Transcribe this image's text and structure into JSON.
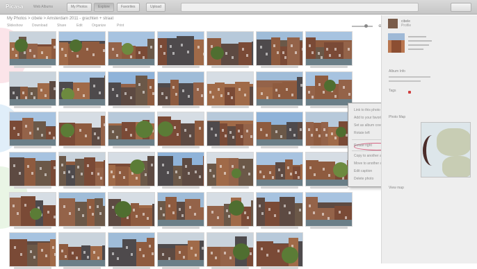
{
  "app": {
    "logo": "Picasa",
    "subtitle": "Web Albums"
  },
  "nav": {
    "items": [
      "My Photos",
      "Explore",
      "Favorites",
      "Upload"
    ],
    "active_index": 1
  },
  "breadcrumb": "My Photos > cibele > Amsterdam 2011 - grachten + straat",
  "toolbar": {
    "items": [
      "Slideshow",
      "Download",
      "Share",
      "Edit",
      "Organize",
      "Print"
    ]
  },
  "colors": {
    "accent": "#d46080",
    "topbar": "#cfcfcf",
    "panel": "#eeeeee"
  },
  "icons": {
    "zoom": "zoom-icon"
  },
  "context_menu": {
    "items": [
      "Link to this photo",
      "Add to your favorites",
      "Set as album cover",
      "Rotate left",
      "Rotate right",
      "Copy to another album",
      "Move to another album",
      "Edit caption",
      "Delete photo"
    ],
    "highlighted_index": 4
  },
  "panel": {
    "user_name": "cibele",
    "user_sub": "Profile",
    "section_labels": [
      "Album Info",
      "Tags",
      "Photo Map"
    ],
    "map_caption": "View map"
  }
}
